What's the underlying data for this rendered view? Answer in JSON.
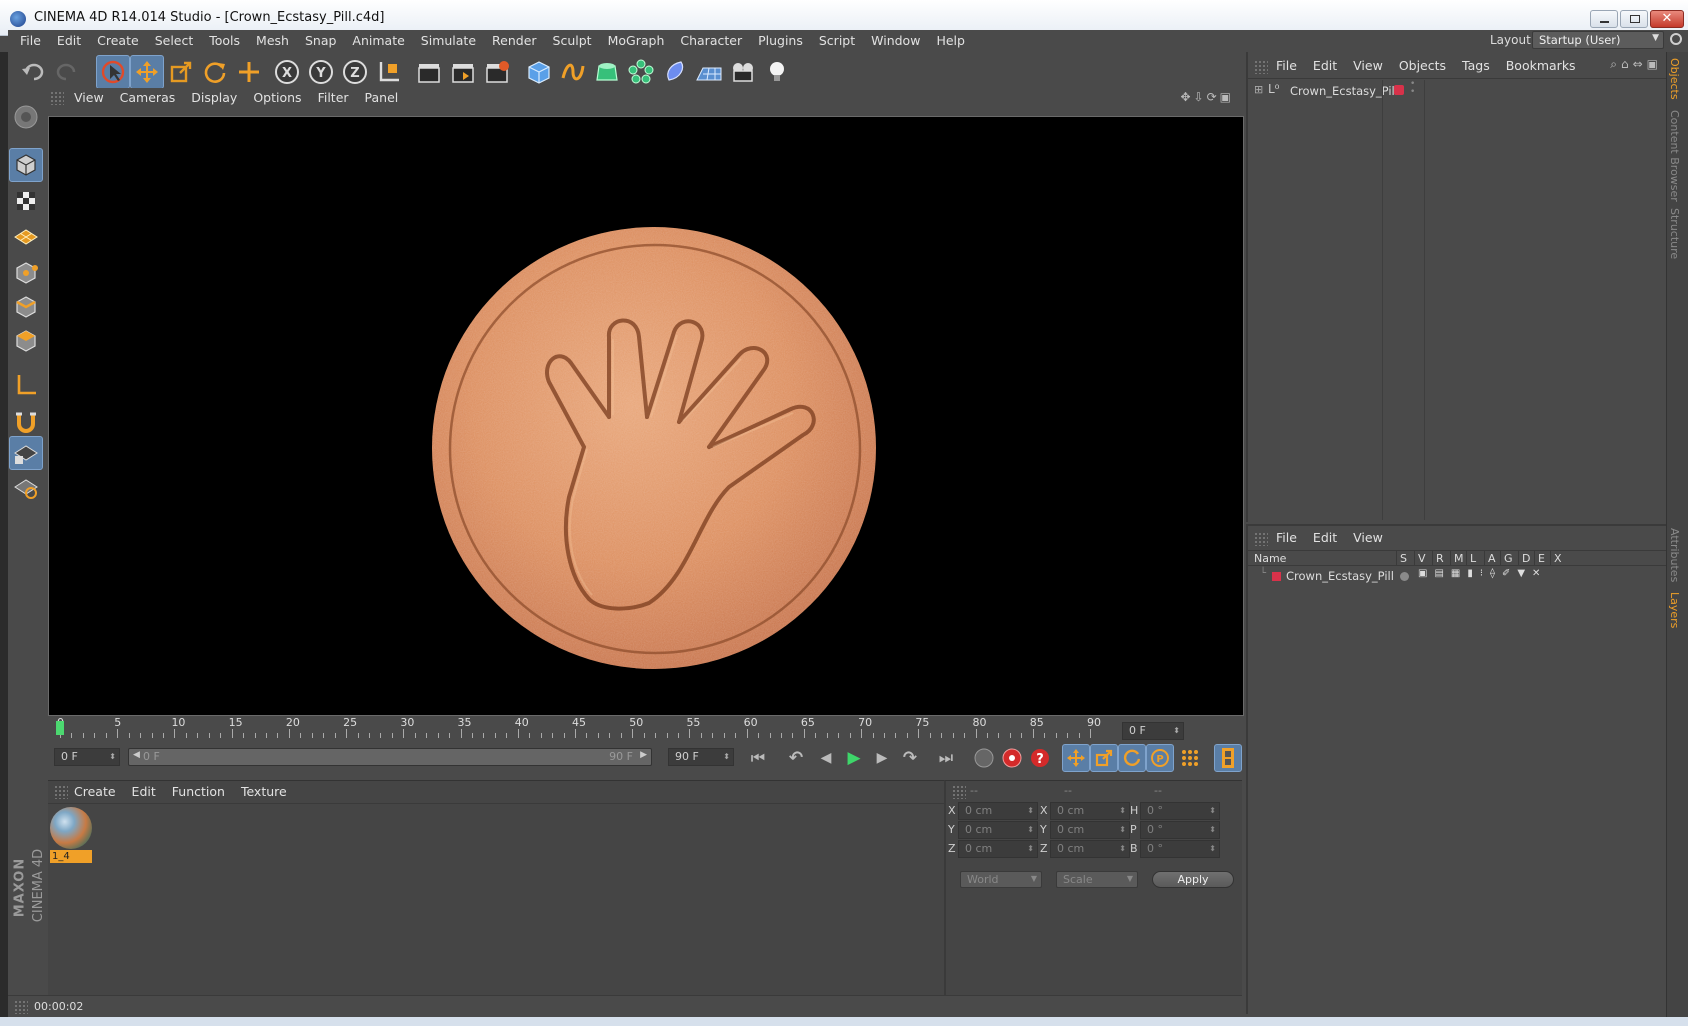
{
  "window": {
    "title": "CINEMA 4D R14.014 Studio - [Crown_Ecstasy_Pill.c4d]"
  },
  "menubar": {
    "items": [
      "File",
      "Edit",
      "Create",
      "Select",
      "Tools",
      "Mesh",
      "Snap",
      "Animate",
      "Simulate",
      "Render",
      "Sculpt",
      "MoGraph",
      "Character",
      "Plugins",
      "Script",
      "Window",
      "Help"
    ],
    "layout_label": "Layout:",
    "layout_value": "Startup (User)"
  },
  "viewport": {
    "menu": [
      "View",
      "Cameras",
      "Display",
      "Options",
      "Filter",
      "Panel"
    ]
  },
  "timeline": {
    "ticks": [
      "0",
      "5",
      "10",
      "15",
      "20",
      "25",
      "30",
      "35",
      "40",
      "45",
      "50",
      "55",
      "60",
      "65",
      "70",
      "75",
      "80",
      "85",
      "90"
    ],
    "current_frame": "0 F",
    "start_frame": "0 F",
    "slider_start": "0 F",
    "slider_end": "90 F",
    "end_frame": "90 F"
  },
  "material_manager": {
    "menu": [
      "Create",
      "Edit",
      "Function",
      "Texture"
    ],
    "material_name": "1_4"
  },
  "coordinates": {
    "headers": [
      "--",
      "--",
      "--"
    ],
    "rows": [
      {
        "a": "X",
        "av": "0 cm",
        "b": "X",
        "bv": "0 cm",
        "c": "H",
        "cv": "0 °"
      },
      {
        "a": "Y",
        "av": "0 cm",
        "b": "Y",
        "bv": "0 cm",
        "c": "P",
        "cv": "0 °"
      },
      {
        "a": "Z",
        "av": "0 cm",
        "b": "Z",
        "bv": "0 cm",
        "c": "B",
        "cv": "0 °"
      }
    ],
    "mode1": "World",
    "mode2": "Scale",
    "apply": "Apply"
  },
  "object_manager": {
    "menu": [
      "File",
      "Edit",
      "View",
      "Objects",
      "Tags",
      "Bookmarks"
    ],
    "object_name": "Crown_Ecstasy_Pill",
    "object_color": "#d8324a"
  },
  "layer_manager": {
    "menu": [
      "File",
      "Edit",
      "View"
    ],
    "columns": [
      "Name",
      "S",
      "V",
      "R",
      "M",
      "L",
      "A",
      "G",
      "D",
      "E",
      "X"
    ],
    "layer_name": "Crown_Ecstasy_Pill"
  },
  "side_tabs": {
    "objects": "Objects",
    "content_browser": "Content Browser",
    "structure": "Structure",
    "attributes": "Attributes",
    "layers": "Layers"
  },
  "status": {
    "time": "00:00:02"
  },
  "brand": {
    "maxon": "MAXON",
    "product": "CINEMA 4D"
  },
  "colors": {
    "accent": "#f0a028",
    "panel": "#4a4a4a",
    "viewport_bg": "#000000"
  }
}
